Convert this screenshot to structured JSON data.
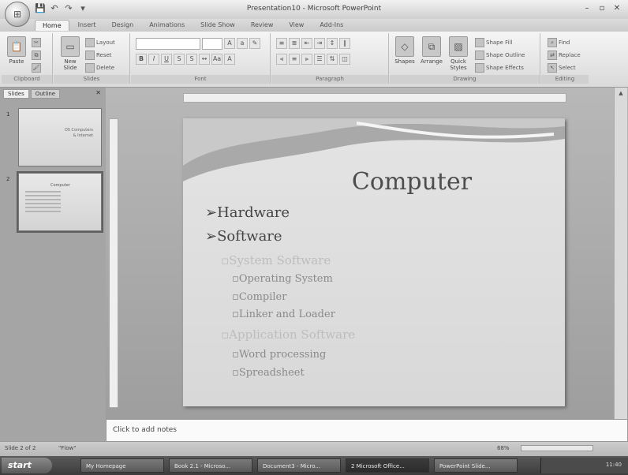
{
  "window": {
    "title": "Presentation10 - Microsoft PowerPoint",
    "controls": [
      "–",
      "▫",
      "✕"
    ]
  },
  "quick_access": [
    "💾",
    "↶",
    "↷",
    "▾"
  ],
  "ribbon": {
    "tabs": [
      "Home",
      "Insert",
      "Design",
      "Animations",
      "Slide Show",
      "Review",
      "View",
      "Add-Ins"
    ],
    "active_tab": "Home",
    "groups": {
      "clipboard": {
        "label": "Clipboard",
        "paste": "Paste"
      },
      "slides": {
        "label": "Slides",
        "new_slide": "New Slide",
        "layout": "Layout",
        "reset": "Reset",
        "delete": "Delete"
      },
      "font": {
        "label": "Font"
      },
      "paragraph": {
        "label": "Paragraph"
      },
      "drawing": {
        "label": "Drawing",
        "shapes": "Shapes",
        "arrange": "Arrange",
        "quick_styles": "Quick Styles",
        "shape_fill": "Shape Fill",
        "shape_outline": "Shape Outline",
        "shape_effects": "Shape Effects"
      },
      "editing": {
        "label": "Editing",
        "find": "Find",
        "replace": "Replace",
        "select": "Select"
      }
    }
  },
  "left_panel": {
    "tabs": [
      "Slides",
      "Outline"
    ],
    "close": "✕",
    "slides": [
      {
        "num": "1",
        "title": "OS Computers",
        "subtitle": "& Internet"
      },
      {
        "num": "2",
        "title": "Computer"
      }
    ]
  },
  "slide": {
    "title": "Computer",
    "bullets": [
      {
        "level": 1,
        "marker": "➢",
        "text": "Hardware"
      },
      {
        "level": 1,
        "marker": "➢",
        "text": "Software"
      },
      {
        "level": 2,
        "marker": "▫",
        "text": "System Software"
      },
      {
        "level": 3,
        "marker": "▫",
        "text": "Operating System"
      },
      {
        "level": 3,
        "marker": "▫",
        "text": "Compiler"
      },
      {
        "level": 3,
        "marker": "▫",
        "text": "Linker and Loader"
      },
      {
        "level": 2,
        "marker": "▫",
        "text": "Application Software"
      },
      {
        "level": 3,
        "marker": "▫",
        "text": "Word processing"
      },
      {
        "level": 3,
        "marker": "▫",
        "text": "Spreadsheet"
      }
    ]
  },
  "notes": {
    "placeholder": "Click to add notes"
  },
  "status": {
    "slide_info": "Slide 2 of 2",
    "theme": "\"Flow\"",
    "zoom": "68%"
  },
  "taskbar": {
    "start": "start",
    "tasks": [
      "My Homepage",
      "Book 2.1 - Microso...",
      "Document3 - Micro...",
      "2 Microsoft Office...",
      "PowerPoint Slide..."
    ],
    "active_task": 3,
    "clock": "11:40"
  }
}
